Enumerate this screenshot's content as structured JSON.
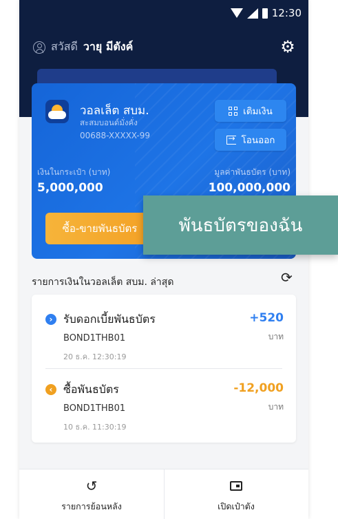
{
  "status_bar": {
    "time": "12:30"
  },
  "header": {
    "greeting_prefix": "สวัสดี",
    "user_name": "วายุ มีตังค์"
  },
  "wallet": {
    "name": "วอลเล็ต สบม.",
    "subtitle": "สะสมบอนด์มั่งคั่ง",
    "account_no": "00688-XXXXX-99",
    "topup_label": "เติมเงิน",
    "transfer_label": "โอนออก",
    "balance_label": "เงินในกระเป๋า (บาท)",
    "balance_value": "5,000,000",
    "bond_value_label": "มูลค่าพันธบัตร (บาท)",
    "bond_value": "100,000,000",
    "buy_sell_label": "ซื้อ-ขายพันธบัตร"
  },
  "tooltip": {
    "label": "พันธบัตรของฉัน"
  },
  "transactions": {
    "title": "รายการเงินในวอลเล็ต สบม. ล่าสุด",
    "items": [
      {
        "title": "รับดอกเบี้ยพันธบัตร",
        "code": "BOND1THB01",
        "date": "20 ธ.ค. 12:30:19",
        "amount": "+520",
        "unit": "บาท",
        "color": "#2f7ff0"
      },
      {
        "title": "ซื้อพันธบัตร",
        "code": "BOND1THB01",
        "date": "10 ธ.ค. 11:30:19",
        "amount": "-12,000",
        "unit": "บาท",
        "color": "#f0a020"
      }
    ]
  },
  "bottom_nav": {
    "history_label": "รายการย้อนหลัง",
    "open_wallet_label": "เปิดเป๋าตัง"
  },
  "icons": {
    "user": "user-icon",
    "settings": "gear-icon",
    "refresh": "refresh-icon",
    "history": "history-icon",
    "wallet": "wallet-icon"
  },
  "colors": {
    "navy": "#0e1e40",
    "card_blue": "#1e74e6",
    "orange": "#f3a126",
    "teal": "#5d9e97"
  }
}
